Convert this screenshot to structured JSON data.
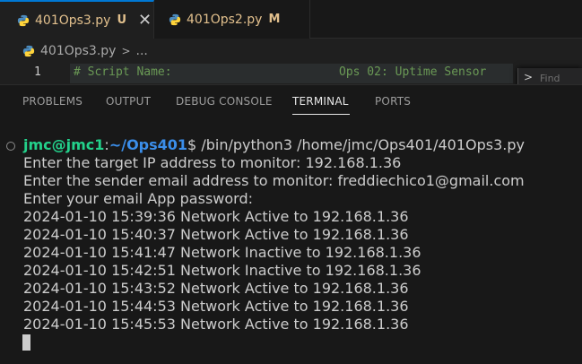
{
  "tabs": [
    {
      "label": "401Ops3.py",
      "badge": "U",
      "active": true
    },
    {
      "label": "401Ops2.py",
      "badge": "M",
      "active": false
    }
  ],
  "tab_close_glyph": "✕",
  "breadcrumb": {
    "file": "401Ops3.py",
    "sep": ">",
    "rest": "..."
  },
  "editor": {
    "line_number": "1",
    "code_name": "# Script Name:",
    "code_value": "Ops 02: Uptime Sensor",
    "find_label": "Find",
    "find_chevron": ">"
  },
  "panel_tabs": [
    "PROBLEMS",
    "OUTPUT",
    "DEBUG CONSOLE",
    "TERMINAL",
    "PORTS"
  ],
  "active_panel_tab": "TERMINAL",
  "terminal": {
    "prompt_user": "jmc@jmc1",
    "prompt_colon": ":",
    "prompt_path": "~/Ops401",
    "prompt_symbol": "$",
    "command": " /bin/python3 /home/jmc/Ops401/401Ops3.py",
    "lines": [
      "Enter the target IP address to monitor: 192.168.1.36",
      "Enter the sender email address to monitor: freddiechico1@gmail.com",
      "Enter your email App password:",
      "2024-01-10 15:39:36 Network Active to 192.168.1.36",
      "2024-01-10 15:40:37 Network Active to 192.168.1.36",
      "2024-01-10 15:41:47 Network Inactive to 192.168.1.36",
      "2024-01-10 15:42:51 Network Inactive to 192.168.1.36",
      "2024-01-10 15:43:52 Network Active to 192.168.1.36",
      "2024-01-10 15:44:53 Network Active to 192.168.1.36",
      "2024-01-10 15:45:53 Network Active to 192.168.1.36"
    ]
  },
  "colors": {
    "accent": "#0078d4",
    "git_badge": "#e2c08d",
    "prompt_user": "#23d18b",
    "prompt_path": "#3b8eea",
    "comment": "#6a9955"
  },
  "icons": [
    "python-file-icon",
    "close-icon",
    "chevron-right-icon",
    "terminal-cursor"
  ]
}
